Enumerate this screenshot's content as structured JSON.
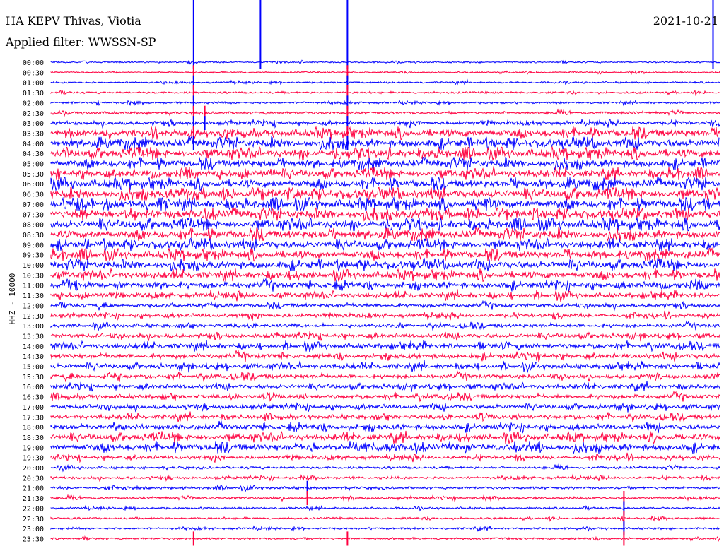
{
  "header": {
    "title": "HA KEPV Thivas, Viotia",
    "filter": "Applied filter: WWSSN-SP",
    "date": "2021-10-21",
    "channel": "HHZ - 10000"
  },
  "chart_data": {
    "type": "line",
    "title": "HA KEPV Thivas, Viotia",
    "subtitle": "Applied filter: WWSSN-SP",
    "xlabel": "",
    "ylabel": "HHZ - 10000",
    "x_unit": "minutes within 30-min row",
    "xlim": [
      0,
      30
    ],
    "row_labels": [
      "00:00",
      "00:30",
      "01:00",
      "01:30",
      "02:00",
      "02:30",
      "03:00",
      "03:30",
      "04:00",
      "04:30",
      "05:00",
      "05:30",
      "06:00",
      "06:30",
      "07:00",
      "07:30",
      "08:00",
      "08:30",
      "09:00",
      "09:30",
      "10:00",
      "10:30",
      "11:00",
      "11:30",
      "12:00",
      "12:30",
      "13:00",
      "13:30",
      "14:00",
      "14:30",
      "15:00",
      "15:30",
      "16:00",
      "16:30",
      "17:00",
      "17:30",
      "18:00",
      "18:30",
      "19:00",
      "19:30",
      "20:00",
      "20:30",
      "21:00",
      "21:30",
      "22:00",
      "22:30",
      "23:00",
      "23:30"
    ],
    "series_colors": [
      "#0000ff",
      "#ff0040"
    ],
    "grid": false,
    "legend": "none",
    "noise_level": [
      0.6,
      0.6,
      0.7,
      0.8,
      0.8,
      1.0,
      1.4,
      2.6,
      2.8,
      2.8,
      2.6,
      2.6,
      2.8,
      3.0,
      3.0,
      3.0,
      3.0,
      2.8,
      2.6,
      2.6,
      2.6,
      2.4,
      2.2,
      1.8,
      1.4,
      1.4,
      1.4,
      1.6,
      1.8,
      1.8,
      1.8,
      1.6,
      1.6,
      1.6,
      1.6,
      1.6,
      2.0,
      2.2,
      2.4,
      1.4,
      1.0,
      1.0,
      1.0,
      0.9,
      0.8,
      0.8,
      0.8,
      0.8
    ],
    "spikes": [
      {
        "x": 6.4,
        "rows": [
          0,
          1,
          2,
          3,
          4,
          5,
          6,
          7,
          8,
          47
        ]
      },
      {
        "x": 13.3,
        "rows": [
          0,
          1,
          2,
          3,
          4,
          5,
          6,
          7,
          8,
          47
        ]
      },
      {
        "x": 6.9,
        "rows": [
          5,
          6
        ]
      },
      {
        "x": 9.4,
        "rows": [
          0
        ]
      },
      {
        "x": 29.7,
        "rows": [
          0
        ]
      },
      {
        "x": 11.5,
        "rows": [
          42,
          43
        ]
      },
      {
        "x": 25.7,
        "rows": [
          43,
          44,
          45,
          46,
          47
        ]
      }
    ]
  }
}
